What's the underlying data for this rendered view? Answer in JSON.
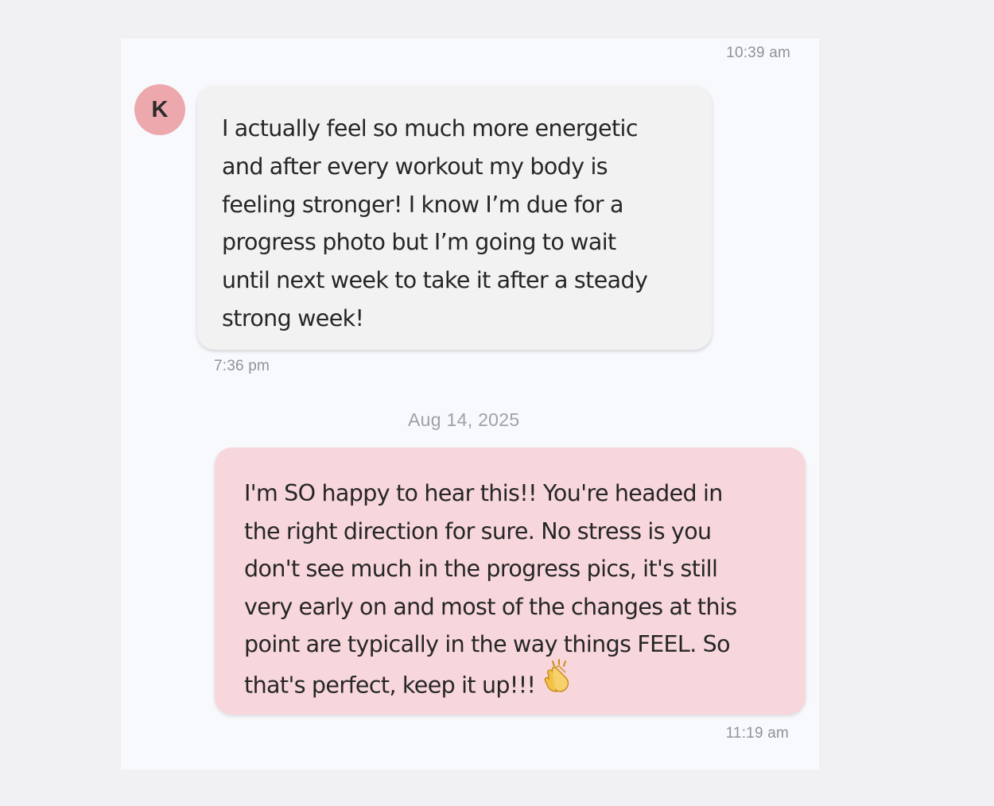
{
  "conversation": {
    "top_timestamp": "10:39 am",
    "incoming": {
      "avatar_initial": "K",
      "lines": [
        "I actually feel so much more energetic",
        "and after every workout my body is",
        "feeling stronger! I know I’m due for a",
        "progress photo but I’m going to wait",
        "until next week to take it after a steady",
        "strong week!"
      ],
      "timestamp": "7:36 pm"
    },
    "date_separator": "Aug 14, 2025",
    "outgoing": {
      "lines": [
        "I'm SO happy to hear this!! You're headed in",
        "the right direction for sure. No stress is you",
        "don't see much in the progress pics, it's still",
        "very early on and most of the changes at this",
        "point are typically in the way things FEEL. So",
        "that's perfect, keep it up!!!"
      ],
      "emoji_icon": "clapping-hands-icon",
      "timestamp": "11:19 am"
    }
  },
  "colors": {
    "page_background": "#f1f1f4",
    "panel_background": "#f8f9fc",
    "incoming_bubble": "#f2f2f3",
    "outgoing_bubble": "#f7d6dc",
    "avatar": "#eda8ae",
    "timestamp_text": "#8f9299"
  }
}
